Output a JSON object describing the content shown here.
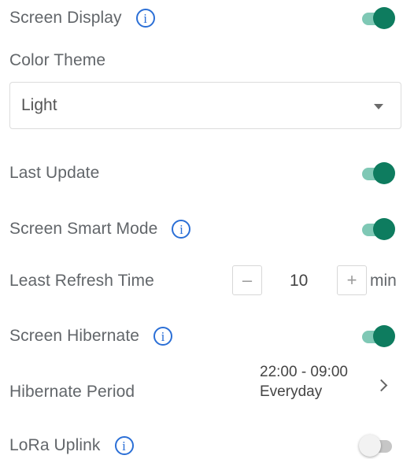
{
  "screen_display": {
    "label": "Screen Display",
    "enabled": true
  },
  "color_theme": {
    "label": "Color Theme",
    "selected": "Light"
  },
  "last_update": {
    "label": "Last Update",
    "enabled": true
  },
  "screen_smart_mode": {
    "label": "Screen Smart Mode",
    "enabled": true
  },
  "least_refresh_time": {
    "label": "Least Refresh Time",
    "minus": "–",
    "value": "10",
    "plus": "+",
    "unit": "min"
  },
  "screen_hibernate": {
    "label": "Screen Hibernate",
    "enabled": true
  },
  "hibernate_period": {
    "label": "Hibernate Period",
    "time": "22:00 - 09:00",
    "repeat": "Everyday"
  },
  "lora_uplink": {
    "label": "LoRa Uplink",
    "enabled": false
  },
  "info_glyph": "i",
  "colors": {
    "accent": "#0e7c5f",
    "accent_track": "#7fc8b5",
    "info_blue": "#2b6fd6"
  }
}
